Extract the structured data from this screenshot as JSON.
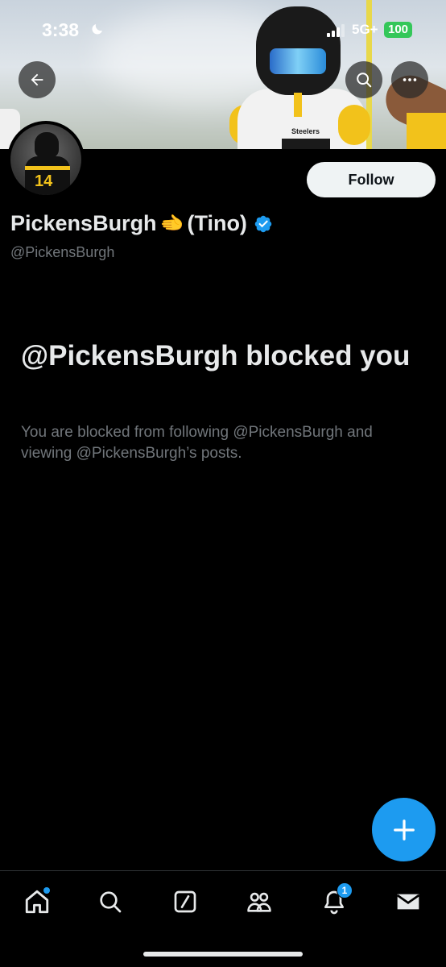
{
  "status_bar": {
    "time": "3:38",
    "network": "5G+",
    "battery": "100",
    "moon_icon": "moon-icon",
    "signal_icon": "signal-icon"
  },
  "header": {
    "back_icon": "arrow-left-icon",
    "search_icon": "search-icon",
    "more_icon": "more-horizontal-icon",
    "banner_jersey_text": "Steelers"
  },
  "avatar": {
    "jersey_number": "14"
  },
  "profile": {
    "follow_label": "Follow",
    "display_name": "PickensBurgh",
    "name_emoji": "🫲",
    "name_suffix": "(Tino)",
    "verified_icon": "verified-badge-icon",
    "handle": "@PickensBurgh"
  },
  "blocked": {
    "title": "@PickensBurgh blocked you",
    "description": "You are blocked from following @PickensBurgh and viewing @PickensBurgh’s posts."
  },
  "fab": {
    "icon": "plus-icon"
  },
  "bottom_nav": {
    "items": [
      {
        "name": "home",
        "icon": "home-icon"
      },
      {
        "name": "search",
        "icon": "search-icon"
      },
      {
        "name": "grok",
        "icon": "grok-icon"
      },
      {
        "name": "communities",
        "icon": "communities-icon"
      },
      {
        "name": "notifications",
        "icon": "bell-icon",
        "badge": "1"
      },
      {
        "name": "messages",
        "icon": "mail-icon"
      }
    ]
  },
  "colors": {
    "accent": "#1d9bf0",
    "background": "#000000",
    "text_primary": "#e7e9ea",
    "text_secondary": "#71767b",
    "battery_green": "#34c759"
  }
}
